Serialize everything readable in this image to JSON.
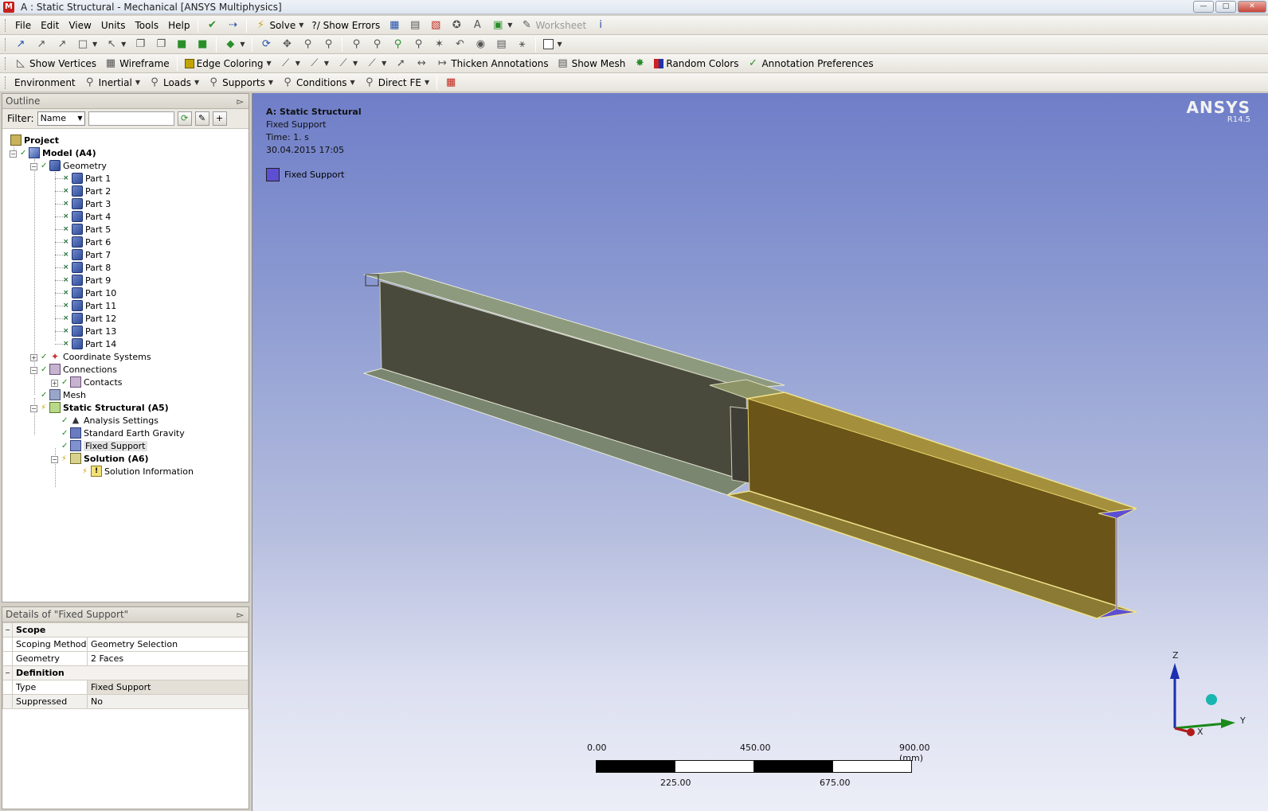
{
  "window": {
    "title": "A : Static Structural - Mechanical [ANSYS Multiphysics]",
    "app_icon": "M",
    "controls": [
      "minimize",
      "maximize",
      "close"
    ]
  },
  "menubar": {
    "items": [
      "File",
      "Edit",
      "View",
      "Units",
      "Tools",
      "Help"
    ],
    "solve_label": "Solve",
    "show_errors_label": "?/ Show Errors",
    "worksheet_label": "Worksheet"
  },
  "toolbar_view": {
    "show_vertices": "Show Vertices",
    "wireframe": "Wireframe",
    "edge_coloring": "Edge Coloring",
    "thicken_annotations": "Thicken Annotations",
    "show_mesh": "Show Mesh",
    "random_colors": "Random Colors",
    "annotation_preferences": "Annotation Preferences"
  },
  "toolbar_env": {
    "environment": "Environment",
    "inertial": "Inertial",
    "loads": "Loads",
    "supports": "Supports",
    "conditions": "Conditions",
    "direct_fe": "Direct FE"
  },
  "outline": {
    "header": "Outline",
    "filter_label": "Filter:",
    "filter_value": "Name",
    "tree": {
      "project": "Project",
      "model": "Model (A4)",
      "geometry": "Geometry",
      "parts": [
        "Part 1",
        "Part 2",
        "Part 3",
        "Part 4",
        "Part 5",
        "Part 6",
        "Part 7",
        "Part 8",
        "Part 9",
        "Part 10",
        "Part 11",
        "Part 12",
        "Part 13",
        "Part 14"
      ],
      "coordinate_systems": "Coordinate Systems",
      "connections": "Connections",
      "contacts": "Contacts",
      "mesh": "Mesh",
      "static_structural": "Static Structural (A5)",
      "analysis_settings": "Analysis Settings",
      "standard_earth_gravity": "Standard Earth Gravity",
      "fixed_support": "Fixed Support",
      "solution": "Solution (A6)",
      "solution_information": "Solution Information"
    }
  },
  "details": {
    "header": "Details of \"Fixed Support\"",
    "groups": [
      {
        "name": "Scope",
        "rows": [
          {
            "key": "Scoping Method",
            "value": "Geometry Selection"
          },
          {
            "key": "Geometry",
            "value": "2 Faces"
          }
        ]
      },
      {
        "name": "Definition",
        "rows": [
          {
            "key": "Type",
            "value": "Fixed Support"
          },
          {
            "key": "Suppressed",
            "value": "No"
          }
        ]
      }
    ]
  },
  "viewport": {
    "analysis_title": "A: Static Structural",
    "object": "Fixed Support",
    "time": "Time: 1. s",
    "date": "30.04.2015 17:05",
    "legend_label": "Fixed Support",
    "legend_color": "#5d4fd2",
    "brand": "ANSYS",
    "version": "R14.5",
    "scale": {
      "labels_top": [
        "0.00",
        "450.00",
        "900.00 (mm)"
      ],
      "labels_bottom": [
        "225.00",
        "675.00"
      ]
    },
    "triad": {
      "z": "Z",
      "y": "Y",
      "x": "X"
    }
  }
}
